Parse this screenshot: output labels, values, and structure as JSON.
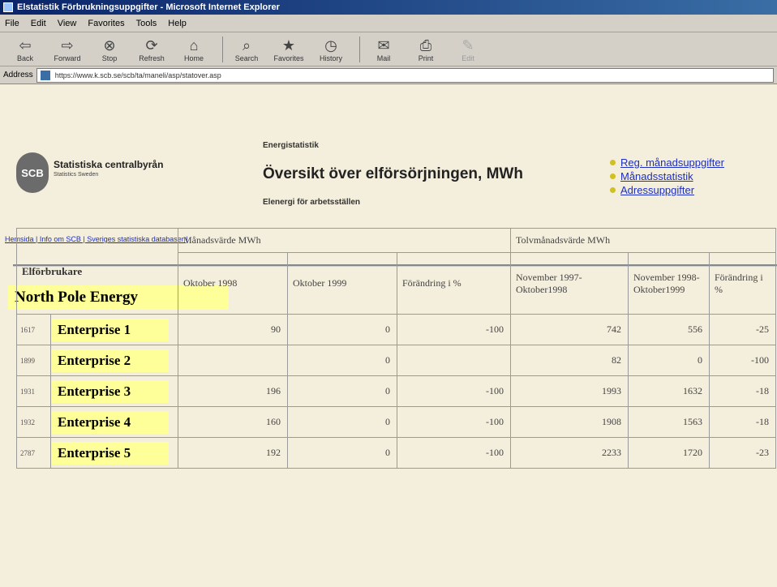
{
  "window": {
    "title": "Elstatistik Förbrukningsuppgifter - Microsoft Internet Explorer"
  },
  "menu": [
    "File",
    "Edit",
    "View",
    "Favorites",
    "Tools",
    "Help"
  ],
  "toolbar": [
    {
      "label": "Back",
      "icon": "⇦"
    },
    {
      "label": "Forward",
      "icon": "⇨"
    },
    {
      "label": "Stop",
      "icon": "⊗"
    },
    {
      "label": "Refresh",
      "icon": "⟳"
    },
    {
      "label": "Home",
      "icon": "⌂"
    },
    {
      "label": "Search",
      "icon": "⌕"
    },
    {
      "label": "Favorites",
      "icon": "★"
    },
    {
      "label": "History",
      "icon": "◷"
    },
    {
      "label": "Mail",
      "icon": "✉"
    },
    {
      "label": "Print",
      "icon": "⎙"
    },
    {
      "label": "Edit",
      "icon": "✎"
    }
  ],
  "address": {
    "label": "Address",
    "url": "https://www.k.scb.se/scb/ta/maneli/asp/statover.asp"
  },
  "org": {
    "logo_text": "SCB",
    "name": "Statistiska centralbyrån",
    "subtitle": "Statistics Sweden"
  },
  "header": {
    "kicker": "Energistatistik",
    "title": "Översikt över elförsörjningen, MWh",
    "subtitle": "Elenergi för arbetsställen"
  },
  "right_links": [
    "Reg. månadsuppgifter",
    "Månadsstatistik",
    "Adressuppgifter"
  ],
  "nav_links": "Hemsida | Info om SCB | Sveriges statistiska databaser |",
  "banner": "North Pole Energy",
  "table": {
    "col_header": "Elförbrukare",
    "group_monthly": "Månadsvärde MWh",
    "group_twelve": "Tolvmånadsvärde MWh",
    "sub": {
      "m1": "Oktober 1998",
      "m2": "Oktober 1999",
      "mchg": "Förändring i %",
      "t1": "November 1997-Oktober1998",
      "t2": "November 1998-Oktober1999",
      "tchg": "Förändring i %"
    },
    "rows": [
      {
        "id": "1617",
        "name": "Enterprise 1",
        "m1": "90",
        "m2": "0",
        "mchg": "-100",
        "t1": "742",
        "t2": "556",
        "tchg": "-25"
      },
      {
        "id": "1899",
        "name": "Enterprise 2",
        "m1": "",
        "m2": "0",
        "mchg": "",
        "t1": "82",
        "t2": "0",
        "tchg": "-100"
      },
      {
        "id": "1931",
        "name": "Enterprise 3",
        "m1": "196",
        "m2": "0",
        "mchg": "-100",
        "t1": "1993",
        "t2": "1632",
        "tchg": "-18"
      },
      {
        "id": "1932",
        "name": "Enterprise 4",
        "m1": "160",
        "m2": "0",
        "mchg": "-100",
        "t1": "1908",
        "t2": "1563",
        "tchg": "-18"
      },
      {
        "id": "2787",
        "name": "Enterprise 5",
        "m1": "192",
        "m2": "0",
        "mchg": "-100",
        "t1": "2233",
        "t2": "1720",
        "tchg": "-23"
      }
    ]
  }
}
